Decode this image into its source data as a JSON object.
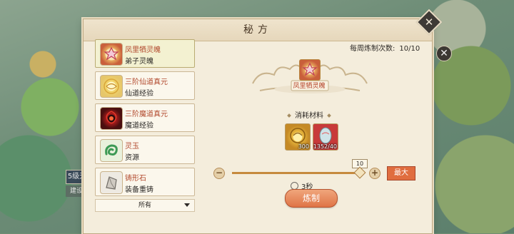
{
  "background": {
    "tag_level": "5级天",
    "tag_build": "建设"
  },
  "panel": {
    "title": "秘方",
    "close_symbol": "✕"
  },
  "recipes": [
    {
      "name": "凤里牺灵魄",
      "sub": "弟子灵魄",
      "icon": "phoenix-soul-icon",
      "selected": true
    },
    {
      "name": "三阶仙道真元",
      "sub": "仙道经验",
      "icon": "immortal-essence-icon",
      "selected": false
    },
    {
      "name": "三阶魔道真元",
      "sub": "魔道经验",
      "icon": "demon-essence-icon",
      "selected": false
    },
    {
      "name": "灵玉",
      "sub": "资源",
      "icon": "spirit-jade-icon",
      "selected": false
    },
    {
      "name": "铸形石",
      "sub": "装备重铸",
      "icon": "forging-stone-icon",
      "selected": false
    }
  ],
  "filter": {
    "label": "所有"
  },
  "detail": {
    "weekly_label": "每周炼制次数:",
    "weekly_value": "10/10",
    "item_name": "凤里牺灵魄",
    "materials_title": "消耗材料",
    "materials": [
      {
        "icon": "gold-coin-icon",
        "count": "300"
      },
      {
        "icon": "egg-icon",
        "count": "1352/40"
      }
    ],
    "quantity": "10",
    "quantity_fraction": 1.0,
    "max_label": "最大",
    "time": "3秒",
    "craft_label": "炼制"
  },
  "colors": {
    "accent": "#e06d3f",
    "item_name": "#b24a2e",
    "panel_bg": "#f4eddc"
  }
}
